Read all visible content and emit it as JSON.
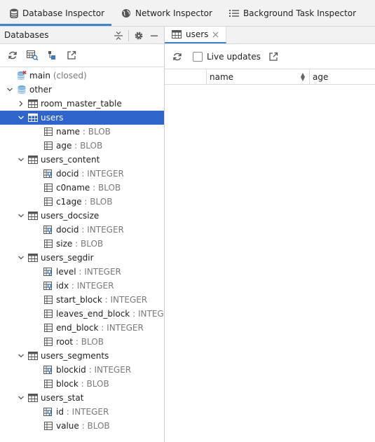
{
  "top_tabs": [
    {
      "label": "Database Inspector",
      "icon": "database-icon"
    },
    {
      "label": "Network Inspector",
      "icon": "globe-icon"
    },
    {
      "label": "Background Task Inspector",
      "icon": "list-icon"
    }
  ],
  "left_panel": {
    "title": "Databases"
  },
  "tree": {
    "main_db": {
      "name": "main",
      "status": "(closed)"
    },
    "other_db": {
      "name": "other"
    },
    "tables": {
      "room_master_table": "room_master_table",
      "users": {
        "name": "users",
        "cols": [
          {
            "name": "name",
            "sep": ":",
            "type": "BLOB"
          },
          {
            "name": "age",
            "sep": ":",
            "type": "BLOB"
          }
        ]
      },
      "users_content": {
        "name": "users_content",
        "cols": [
          {
            "name": "docid",
            "sep": ":",
            "type": "INTEGER"
          },
          {
            "name": "c0name",
            "sep": ":",
            "type": "BLOB"
          },
          {
            "name": "c1age",
            "sep": ":",
            "type": "BLOB"
          }
        ]
      },
      "users_docsize": {
        "name": "users_docsize",
        "cols": [
          {
            "name": "docid",
            "sep": ":",
            "type": "INTEGER"
          },
          {
            "name": "size",
            "sep": ":",
            "type": "BLOB"
          }
        ]
      },
      "users_segdir": {
        "name": "users_segdir",
        "cols": [
          {
            "name": "level",
            "sep": ":",
            "type": "INTEGER"
          },
          {
            "name": "idx",
            "sep": ":",
            "type": "INTEGER"
          },
          {
            "name": "start_block",
            "sep": ":",
            "type": "INTEGER"
          },
          {
            "name": "leaves_end_block",
            "sep": ":",
            "type": "INTEGER"
          },
          {
            "name": "end_block",
            "sep": ":",
            "type": "INTEGER"
          },
          {
            "name": "root",
            "sep": ":",
            "type": "BLOB"
          }
        ]
      },
      "users_segments": {
        "name": "users_segments",
        "cols": [
          {
            "name": "blockid",
            "sep": ":",
            "type": "INTEGER"
          },
          {
            "name": "block",
            "sep": ":",
            "type": "BLOB"
          }
        ]
      },
      "users_stat": {
        "name": "users_stat",
        "cols": [
          {
            "name": "id",
            "sep": ":",
            "type": "INTEGER"
          },
          {
            "name": "value",
            "sep": ":",
            "type": "BLOB"
          }
        ]
      }
    }
  },
  "right_panel": {
    "tab_label": "users",
    "live_updates_label": "Live updates",
    "columns": [
      "name",
      "age"
    ]
  },
  "colors": {
    "accent": "#4083c9",
    "selection": "#2f65ca"
  }
}
